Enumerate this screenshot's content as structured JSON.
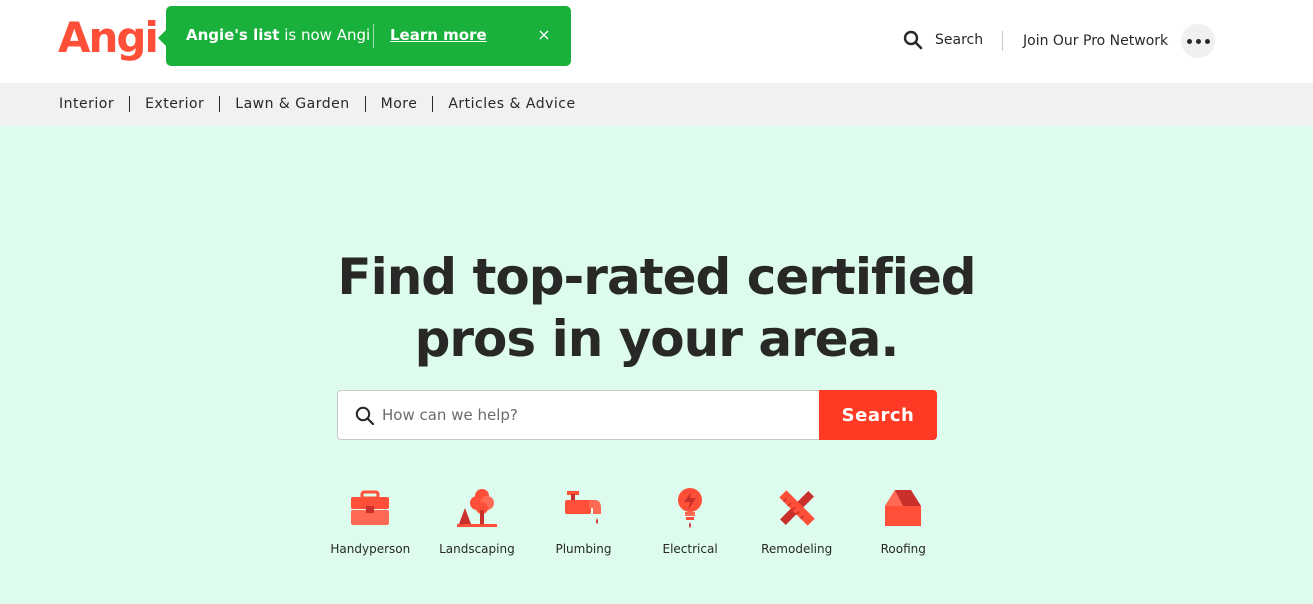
{
  "header": {
    "logo_text": "Angi",
    "banner": {
      "brand": "Angie's list",
      "text": "is now Angi",
      "link": "Learn more",
      "close": "×"
    },
    "search_label": "Search",
    "pro_network": "Join Our Pro Network"
  },
  "nav": {
    "items": [
      "Interior",
      "Exterior",
      "Lawn & Garden",
      "More",
      "Articles & Advice"
    ]
  },
  "hero": {
    "title_line1": "Find top-rated certified",
    "title_line2": "pros in your area.",
    "search_placeholder": "How can we help?",
    "search_button": "Search"
  },
  "categories": [
    {
      "label": "Handyperson",
      "icon": "toolbox-icon"
    },
    {
      "label": "Landscaping",
      "icon": "tree-icon"
    },
    {
      "label": "Plumbing",
      "icon": "faucet-icon"
    },
    {
      "label": "Electrical",
      "icon": "lightbulb-icon"
    },
    {
      "label": "Remodeling",
      "icon": "ruler-pencil-icon"
    },
    {
      "label": "Roofing",
      "icon": "roof-icon"
    }
  ],
  "colors": {
    "brand": "#ff4f38",
    "banner": "#1ab03c",
    "hero_bg": "#ddfcee",
    "search_button": "#ff3a24",
    "nav_bg": "#f0f1f3"
  }
}
